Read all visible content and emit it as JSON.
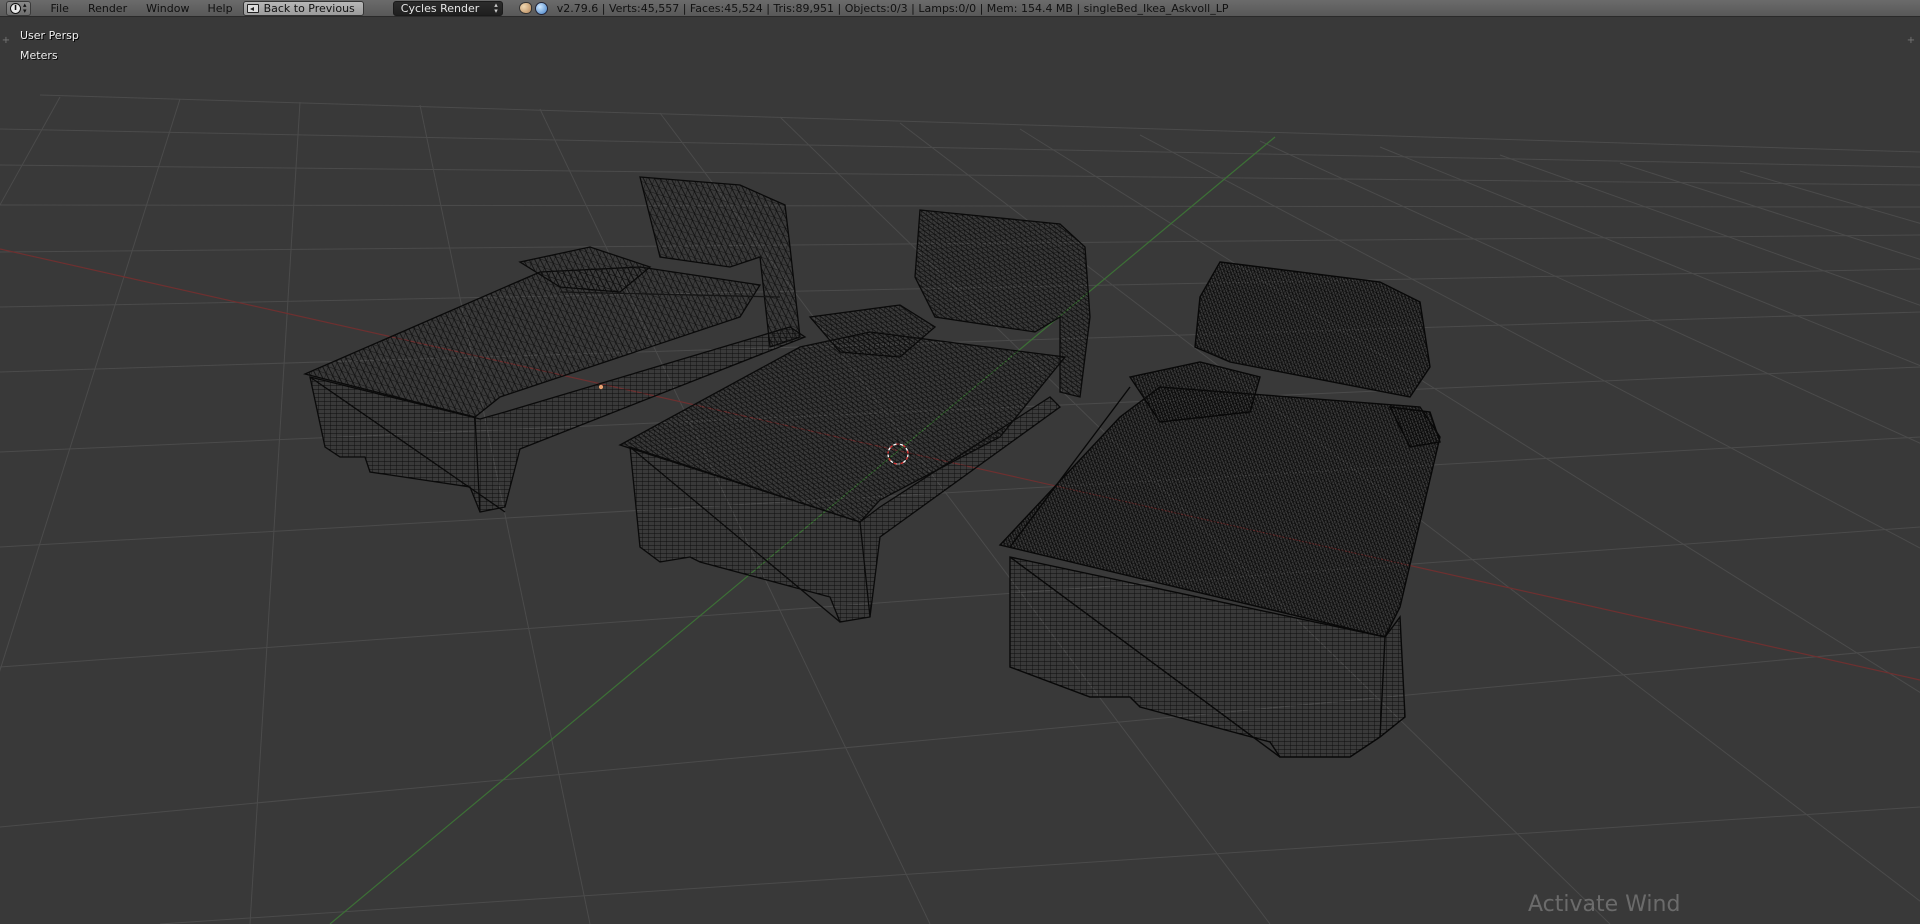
{
  "header": {
    "info_glyph": "i",
    "menus": [
      {
        "label": "File"
      },
      {
        "label": "Render"
      },
      {
        "label": "Window"
      },
      {
        "label": "Help"
      }
    ],
    "back_button_label": "Back to Previous",
    "render_engine": "Cycles Render",
    "stats": "v2.79.6 | Verts:45,557 | Faces:45,524 | Tris:89,951 | Objects:0/3 | Lamps:0/0 | Mem: 154.4 MB | singleBed_Ikea_Askvoll_LP"
  },
  "viewport": {
    "view_name": "User Persp",
    "units": "Meters",
    "shading": "wireframe",
    "watermark": "Activate Wind"
  },
  "colors": {
    "background": "#393939",
    "grid": "#4a4a4a",
    "x_axis": "#7a3434",
    "y_axis": "#3f7a3a",
    "wireframe": "#0c0c0c",
    "header": "#5f5f5f"
  },
  "icons": {
    "editor_type": "info-icon",
    "back": "back-to-previous-icon",
    "scene": "scene-icon",
    "world": "world-icon"
  }
}
